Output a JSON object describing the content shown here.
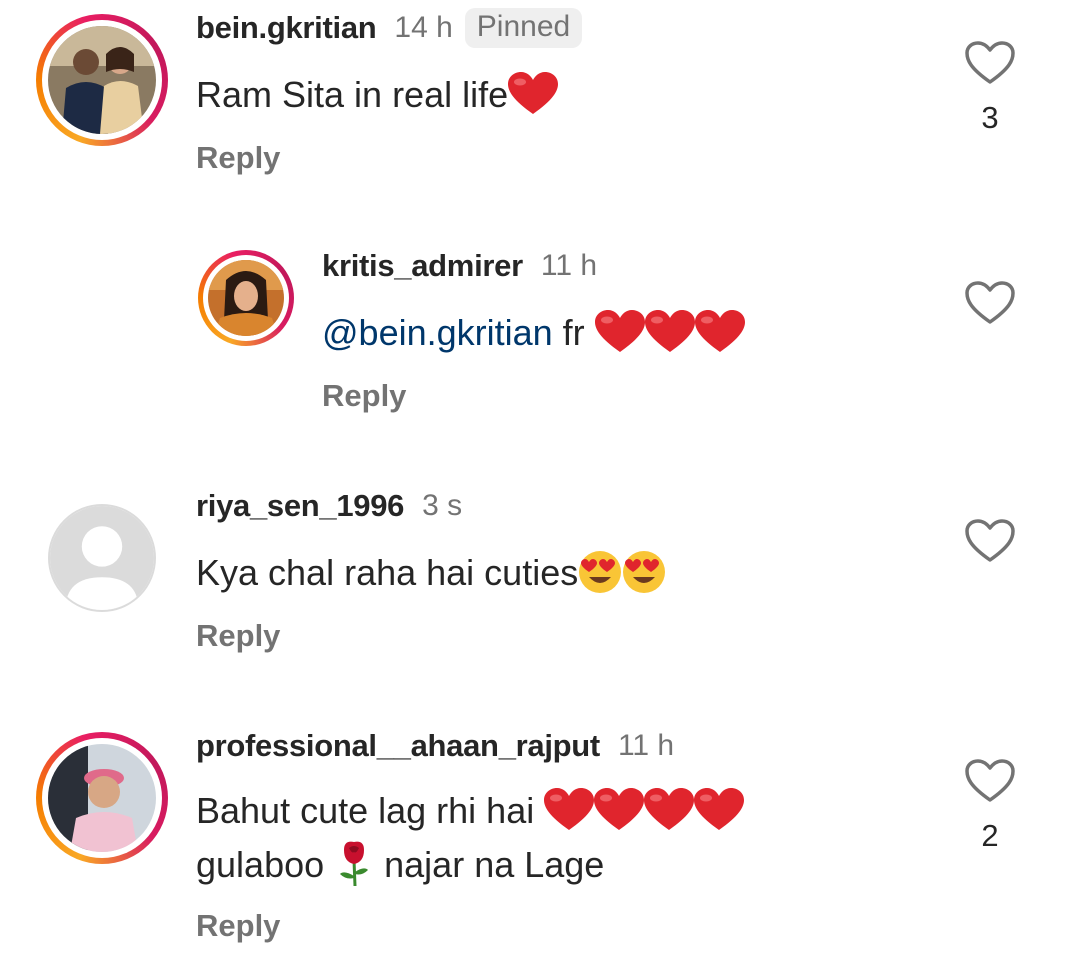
{
  "comments": [
    {
      "username": "bein.gkritian",
      "time": "14 h",
      "badge": "Pinned",
      "text": "Ram Sita in real life",
      "emoji": [
        "red-heart"
      ],
      "reply_label": "Reply",
      "likes": "3"
    },
    {
      "username": "kritis_admirer",
      "time": "11 h",
      "mention": "@bein.gkritian",
      "text": " fr ",
      "emoji": [
        "red-heart",
        "red-heart",
        "red-heart"
      ],
      "reply_label": "Reply",
      "likes": ""
    },
    {
      "username": "riya_sen_1996",
      "time": "3 s",
      "text": "Kya chal raha hai cuties",
      "emoji": [
        "heart-eyes-emoji",
        "heart-eyes-emoji"
      ],
      "reply_label": "Reply",
      "likes": ""
    },
    {
      "username": "professional__ahaan_rajput",
      "time": "11 h",
      "text_line1": "Bahut cute lag rhi hai ",
      "emoji_line1": [
        "red-heart",
        "red-heart",
        "red-heart",
        "red-heart"
      ],
      "text_line2a": "gulaboo ",
      "emoji_line2": [
        "rose"
      ],
      "text_line2b": " najar na Lage",
      "reply_label": "Reply",
      "likes": "2"
    }
  ],
  "colors": {
    "username": "#262626",
    "secondary": "#737373",
    "mention": "#00376b",
    "heart_emoji": "#e0252d",
    "story_ring_start": "#f9a825",
    "story_ring_end": "#d81b60"
  },
  "icons": {
    "like": "heart-outline-icon",
    "default_avatar": "person-silhouette-icon"
  }
}
